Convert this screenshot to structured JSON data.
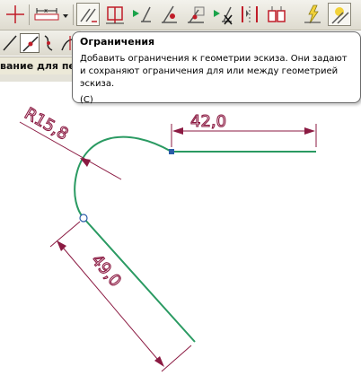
{
  "toolbar": {
    "buttons": [
      {
        "icon": "crosshair-icon"
      },
      {
        "icon": "dimension-icon"
      },
      {
        "icon": "dropdown-arrow-icon"
      },
      {
        "icon": "constraint-icon"
      },
      {
        "icon": "fixed-constraint-icon"
      },
      {
        "icon": "perpendicular-constraint-icon"
      },
      {
        "icon": "tangent-constraint-icon"
      },
      {
        "icon": "parallel-constraint-icon"
      },
      {
        "icon": "delete-constraint-icon"
      },
      {
        "icon": "symmetric-constraint-icon"
      },
      {
        "icon": "equal-constraint-icon"
      },
      {
        "icon": "auto-constraint-icon"
      },
      {
        "icon": "show-constraints-icon"
      }
    ],
    "colors": {
      "accent_green": "#1aa34a",
      "accent_red": "#d0202f",
      "accent_yellow": "#f2d23a"
    }
  },
  "toolbar2": {
    "buttons": [
      {
        "icon": "line-icon"
      },
      {
        "icon": "point-on-curve-icon"
      },
      {
        "icon": "spline-icon"
      },
      {
        "icon": "trim-icon"
      }
    ]
  },
  "cmdline": {
    "text": "вание для пер"
  },
  "tooltip": {
    "title": "Ограничения",
    "body": "Добавить ограничения к геометрии эскиза. Они задают и сохраняют ограничения для или между геометрией эскиза.",
    "note": "(C)"
  },
  "sketch": {
    "dimensions": {
      "horizontal": "42,0",
      "radius": "R15,8",
      "linear": "49,0"
    },
    "colors": {
      "geometry": "#2a9a62",
      "dimension": "#8b1a42",
      "point": "#2a5ca8"
    }
  }
}
